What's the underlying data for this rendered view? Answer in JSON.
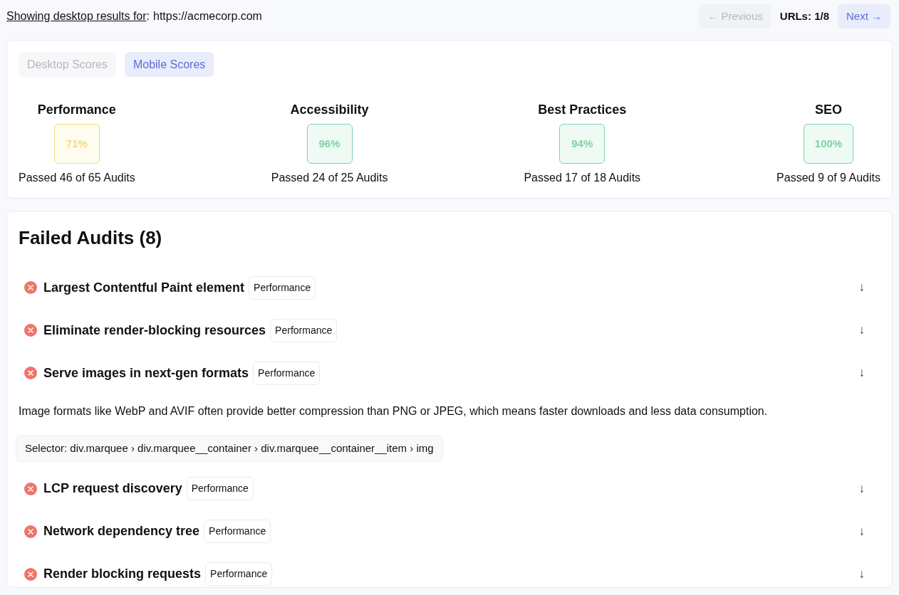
{
  "header": {
    "prefix": "Showing desktop results for",
    "separator": ":",
    "url": "https://acmecorp.com",
    "previous": {
      "label": "← Previous",
      "disabled": true
    },
    "counter": "URLs: 1/8",
    "next": {
      "label": "Next →",
      "disabled": false
    }
  },
  "tabs": [
    {
      "label": "Desktop Scores",
      "selected": false
    },
    {
      "label": "Mobile Scores",
      "selected": true
    }
  ],
  "scores": [
    {
      "name": "Performance",
      "value": "71%",
      "passed": "Passed 46 of 65 Audits",
      "color": "#f3dc7a"
    },
    {
      "name": "Accessibility",
      "value": "96%",
      "passed": "Passed 24 of 25 Audits",
      "color": "#7fd3a6"
    },
    {
      "name": "Best Practices",
      "value": "94%",
      "passed": "Passed 17 of 18 Audits",
      "color": "#7fd3a6"
    },
    {
      "name": "SEO",
      "value": "100%",
      "passed": "Passed 9 of 9 Audits",
      "color": "#7fd3a6"
    }
  ],
  "failed_audits": {
    "title": "Failed Audits (8)",
    "items": [
      {
        "title": "Largest Contentful Paint element",
        "category": "Performance",
        "toggle": "↓"
      },
      {
        "title": "Eliminate render-blocking resources",
        "category": "Performance",
        "toggle": "↓"
      },
      {
        "title": "Serve images in next-gen formats",
        "category": "Performance",
        "toggle": "↓",
        "description": "Image formats like WebP and AVIF often provide better compression than PNG or JPEG, which means faster downloads and less data consumption.",
        "selector": "Selector: div.marquee › div.marquee__container › div.marquee__container__item › img"
      },
      {
        "title": "LCP request discovery",
        "category": "Performance",
        "toggle": "↓"
      },
      {
        "title": "Network dependency tree",
        "category": "Performance",
        "toggle": "↓"
      },
      {
        "title": "Render blocking requests",
        "category": "Performance",
        "toggle": "↓"
      }
    ]
  }
}
